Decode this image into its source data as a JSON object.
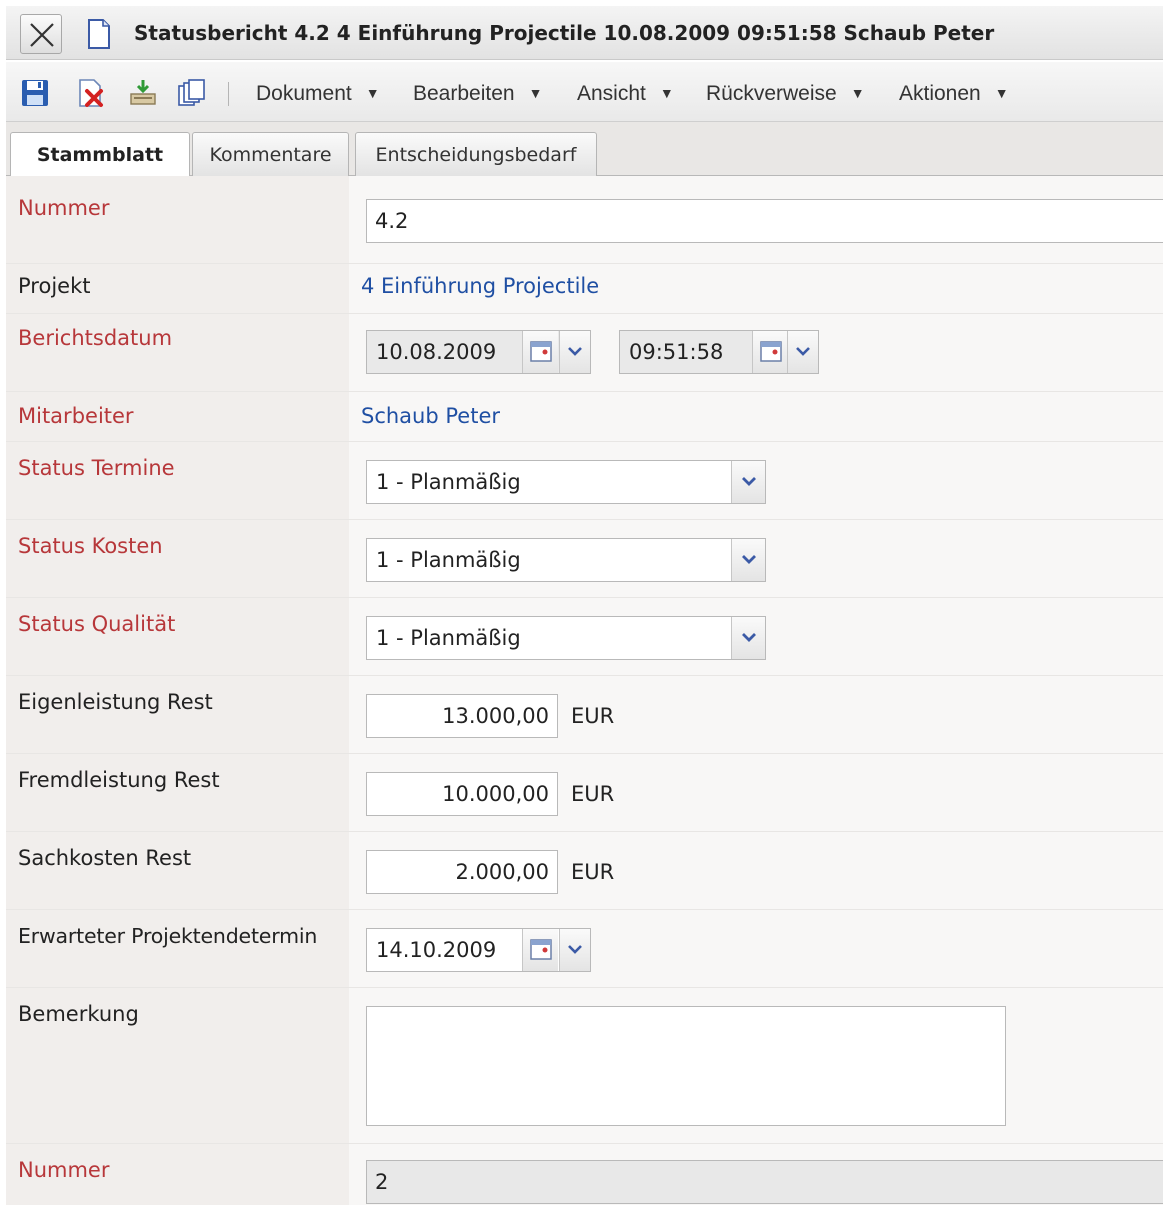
{
  "window": {
    "title": "Statusbericht 4.2 4 Einführung Projectile 10.08.2009 09:51:58 Schaub Peter"
  },
  "toolbar": {
    "icons": [
      "save-icon",
      "delete-icon",
      "export-icon",
      "copy-icon"
    ],
    "menus": [
      "Dokument",
      "Bearbeiten",
      "Ansicht",
      "Rückverweise",
      "Aktionen"
    ],
    "caret": "▼"
  },
  "tabs": [
    {
      "label": "Stammblatt",
      "active": true
    },
    {
      "label": "Kommentare",
      "active": false
    },
    {
      "label": "Entscheidungsbedarf",
      "active": false
    }
  ],
  "form": {
    "nummer": {
      "label": "Nummer",
      "value": "4.2"
    },
    "projekt": {
      "label": "Projekt",
      "value": "4 Einführung Projectile"
    },
    "berichtsdatum": {
      "label": "Berichtsdatum",
      "date": "10.08.2009",
      "time": "09:51:58"
    },
    "mitarbeiter": {
      "label": "Mitarbeiter",
      "value": "Schaub Peter"
    },
    "status_termine": {
      "label": "Status Termine",
      "value": "1 - Planmäßig"
    },
    "status_kosten": {
      "label": "Status Kosten",
      "value": "1 - Planmäßig"
    },
    "status_qualitaet": {
      "label": "Status Qualität",
      "value": "1 - Planmäßig"
    },
    "eigenleistung": {
      "label": "Eigenleistung Rest",
      "value": "13.000,00",
      "unit": "EUR"
    },
    "fremdleistung": {
      "label": "Fremdleistung Rest",
      "value": "10.000,00",
      "unit": "EUR"
    },
    "sachkosten": {
      "label": "Sachkosten Rest",
      "value": "2.000,00",
      "unit": "EUR"
    },
    "projektende": {
      "label": "Erwarteter Projektendetermin",
      "date": "14.10.2009"
    },
    "bemerkung": {
      "label": "Bemerkung",
      "value": ""
    },
    "nummer2": {
      "label": "Nummer",
      "value": "2"
    }
  },
  "colors": {
    "required_label": "#b7373a",
    "link": "#1f4fa3",
    "label_bg": "#f1eeec"
  }
}
